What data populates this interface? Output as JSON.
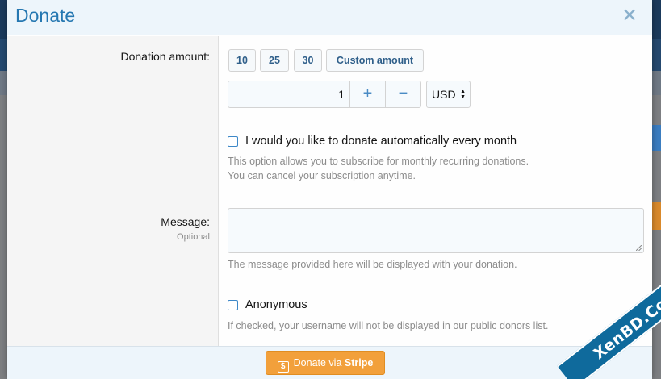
{
  "dialog": {
    "title": "Donate",
    "close_glyph": "✕"
  },
  "amount": {
    "label": "Donation amount:",
    "presets": [
      "10",
      "25",
      "30"
    ],
    "custom_label": "Custom amount",
    "quantity_value": "1",
    "plus_glyph": "+",
    "minus_glyph": "−",
    "currency": "USD"
  },
  "recurring": {
    "label": "I would you like to donate automatically every month",
    "explain_line1": "This option allows you to subscribe for monthly recurring donations.",
    "explain_line2": "You can cancel your subscription anytime."
  },
  "message": {
    "label": "Message:",
    "hint": "Optional",
    "value": "",
    "explain": "The message provided here will be displayed with your donation."
  },
  "anonymous": {
    "label": "Anonymous",
    "explain": "If checked, your username will not be displayed in our public donors list."
  },
  "footer": {
    "button_prefix": "Donate via",
    "button_brand": "Stripe",
    "icon": "dollar-icon"
  },
  "watermark": {
    "text": "XenBD.Com"
  },
  "colors": {
    "title": "#2577b1",
    "accent": "#f2a03b",
    "link": "#2f5f8a"
  }
}
